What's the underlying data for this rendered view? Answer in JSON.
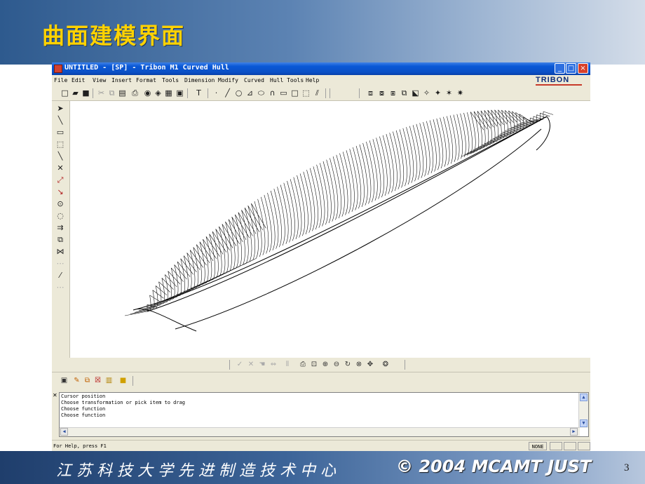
{
  "slide": {
    "title": "曲面建模界面",
    "footer_school": "江苏科技大学先进制造技术中心",
    "footer_copyright": "© 2004 MCAMT JUST",
    "page_number": "3"
  },
  "window": {
    "title": "UNTITLED - [SP] - Tribon M1 Curved Hull",
    "brand": "TRIBON",
    "controls": [
      "_",
      "□",
      "×"
    ]
  },
  "menu": [
    "File",
    "Edit",
    "View",
    "Insert",
    "Format",
    "Tools",
    "Dimension",
    "Modify",
    "Curved",
    "Hull Tools",
    "Help"
  ],
  "messages": {
    "lines": [
      "Cursor position",
      "Choose transformation or pick item to drag",
      "Choose function",
      "Choose function"
    ]
  },
  "status": {
    "help": "For Help, press F1",
    "mode": "NONE"
  },
  "colors": {
    "title_yellow": "#ffd200",
    "header_blue": "#2e5a8e",
    "xp_title_blue": "#0a58d6"
  },
  "icons": {
    "left_toolbar": [
      "select-arrow-icon",
      "line-icon",
      "rectangle-icon",
      "box-icon",
      "diagonal-line-icon",
      "cross-icon",
      "curve-point-icon",
      "point-pick-icon",
      "circle-center-icon",
      "arc-icon",
      "parallel-lines-icon",
      "copy-icon",
      "intersect-icon",
      "dashed-icon",
      "trim-icon",
      "extend-icon"
    ]
  }
}
